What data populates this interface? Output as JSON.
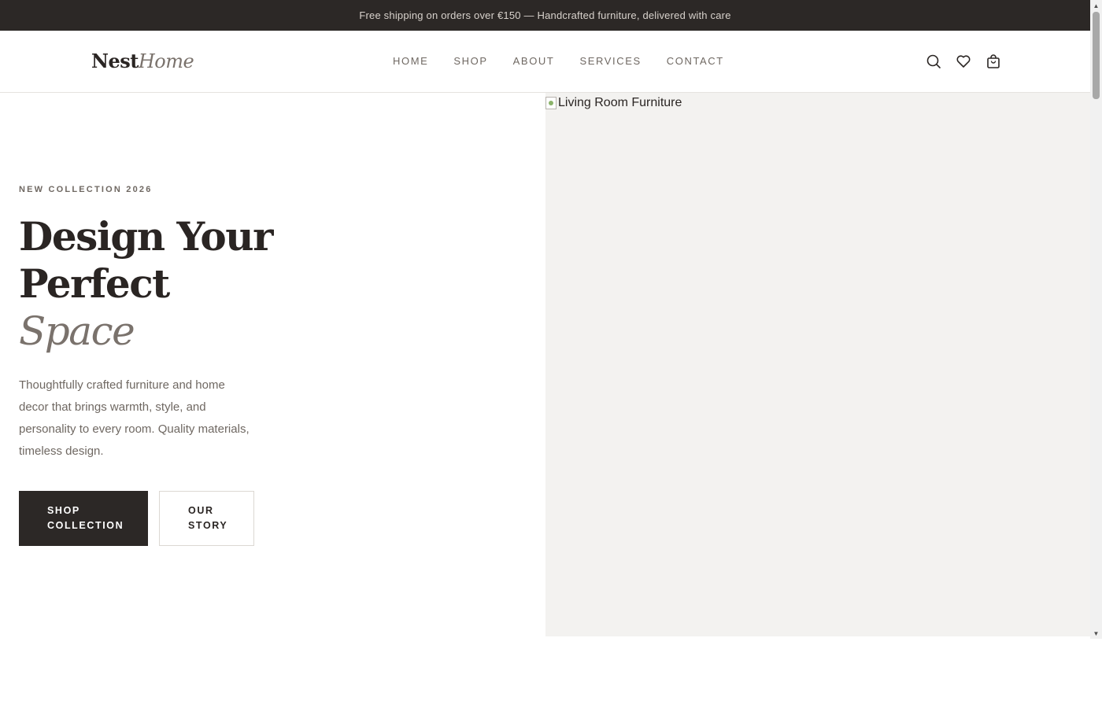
{
  "announcement": {
    "text": "Free shipping on orders over €150 — Handcrafted furniture, delivered with care"
  },
  "header": {
    "logo_primary": "Nest",
    "logo_accent": "Home",
    "nav": [
      "HOME",
      "SHOP",
      "ABOUT",
      "SERVICES",
      "CONTACT"
    ],
    "icons": [
      "search-icon",
      "heart-icon",
      "shopping-bag-icon"
    ]
  },
  "hero": {
    "eyebrow": "NEW COLLECTION 2026",
    "headline_line1": "Design Your",
    "headline_line2": "Perfect",
    "headline_accent": "Space",
    "subtext": "Thoughtfully crafted furniture and home decor that brings warmth, style, and personality to every room. Quality materials, timeless design.",
    "primary_button": "SHOP COLLECTION",
    "secondary_button": "OUR STORY",
    "image_alt": "Living Room Furniture"
  },
  "colors": {
    "dark": "#2c2826",
    "muted": "#7a726c",
    "image_bg": "#f3f2f0"
  }
}
